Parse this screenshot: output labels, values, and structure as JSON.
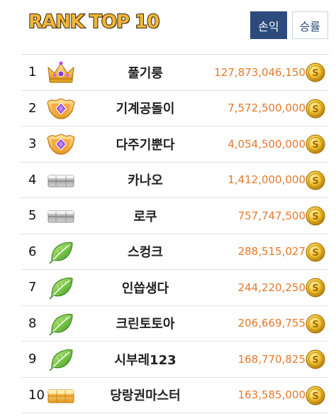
{
  "header": {
    "title": "RANK TOP 10"
  },
  "tabs": [
    {
      "label": "손익",
      "active": true
    },
    {
      "label": "승률",
      "active": false
    }
  ],
  "colors": {
    "accent": "#2c4b7c",
    "amount": "#e5782a",
    "title": "#f0b53a"
  },
  "ranking": [
    {
      "rank": "1",
      "badge": "crown-icon",
      "name": "풀기룽",
      "amount": "127,873,046,150"
    },
    {
      "rank": "2",
      "badge": "gem-emblem-icon",
      "name": "기계공돌이",
      "amount": "7,572,500,000"
    },
    {
      "rank": "3",
      "badge": "gem-emblem-icon",
      "name": "다주기뿐다",
      "amount": "4,054,500,000"
    },
    {
      "rank": "4",
      "badge": "silver-bar-icon",
      "name": "카나오",
      "amount": "1,412,000,000"
    },
    {
      "rank": "5",
      "badge": "silver-bar-icon",
      "name": "로쿠",
      "amount": "757,747,500"
    },
    {
      "rank": "6",
      "badge": "leaf-icon",
      "name": "스컹크",
      "amount": "288,515,027"
    },
    {
      "rank": "7",
      "badge": "leaf-icon",
      "name": "인씁생다",
      "amount": "244,220,250"
    },
    {
      "rank": "8",
      "badge": "leaf-icon",
      "name": "크린토토아",
      "amount": "206,669,755"
    },
    {
      "rank": "9",
      "badge": "leaf-icon",
      "name": "시부레123",
      "amount": "168,770,825"
    },
    {
      "rank": "10",
      "badge": "gold-bar-icon",
      "name": "당랑권마스터",
      "amount": "163,585,000"
    }
  ]
}
